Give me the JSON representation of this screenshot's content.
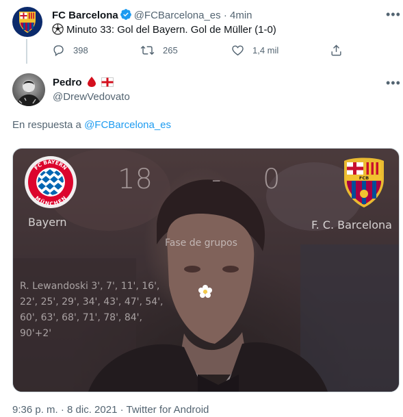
{
  "parent_tweet": {
    "name": "FC Barcelona",
    "handle": "@FCBarcelona_es",
    "separator": "·",
    "time": "4min",
    "text": "Minuto 33: Gol del Bayern. Gol de Müller (1-0)",
    "stats": {
      "replies": "398",
      "retweets": "265",
      "likes": "1,4 mil"
    },
    "icons": [
      "verified-badge-icon",
      "soccer-ball-icon",
      "reply-icon",
      "retweet-icon",
      "like-icon",
      "share-icon",
      "more-icon"
    ]
  },
  "reply_tweet": {
    "name": "Pedro",
    "name_emoji": "🩸 ✚",
    "handle": "@DrewVedovato",
    "reply_prefix": "En respuesta a",
    "reply_handle": "@FCBarcelona_es",
    "image": {
      "left_team": "Bayern",
      "right_team": "F. C. Barcelona",
      "score_left": "18",
      "score_sep": "-",
      "score_right": "0",
      "phase": "Fase de grupos",
      "goals": "R. Lewandoski 3', 7', 11', 16', 22', 25', 29', 34', 43', 47', 54', 60', 63', 68', 71', 78', 84', 90'+2'",
      "bayern_logo_text": "FC BAYERN MÜNCHEN",
      "fcb_logo_text": "FCB"
    },
    "meta": "9:36 p. m. · 8 dic. 2021 · Twitter for Android"
  },
  "colors": {
    "text": "#0f1419",
    "muted": "#536471",
    "link": "#1d9bf0",
    "verified": "#1d9bf0",
    "divider": "#cfd9de",
    "bayern_red": "#dc052d",
    "bayern_blue": "#0066b2",
    "barca_blue": "#004d98",
    "barca_red": "#a50044"
  }
}
